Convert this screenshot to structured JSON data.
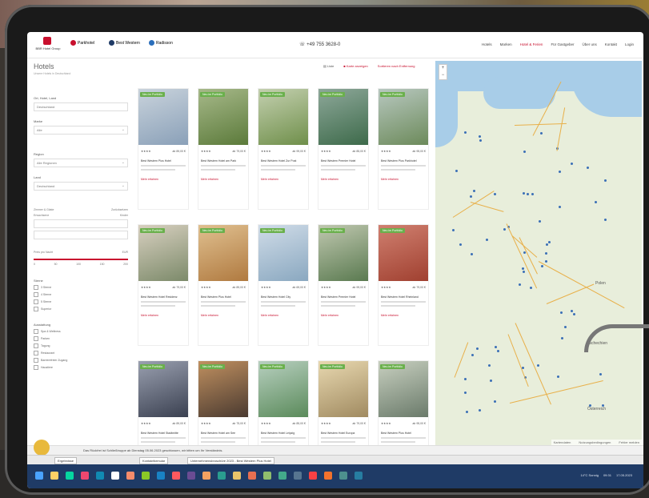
{
  "header": {
    "logo_text": "BBR Hotel Group",
    "partner_logos": [
      "Parkhotel",
      "Best Western",
      "Radisson"
    ],
    "phone": "+49 755 3628-0",
    "nav": [
      "Hotels",
      "Marken",
      "Hotel & Ferien",
      "Für Gastgeber",
      "Über uns",
      "Kontakt",
      "Login"
    ]
  },
  "page": {
    "title": "Hotels",
    "subtitle": "Unsere Hotels in Deutschland"
  },
  "sortbar": {
    "view": "Liste",
    "map_toggle": "Karte anzeigen",
    "sort": "Sortieren nach Entfernung"
  },
  "filters": {
    "search_label": "Ort, Hotel, Land",
    "search_value": "Deutschland",
    "brand_label": "Marke",
    "brand_value": "Alle",
    "region_label": "Region",
    "region_value": "Alle Regionen",
    "country_label": "Land",
    "country_value": "Deutschland",
    "rooms_label": "Zimmer & Gäste",
    "rooms_reset": "Zurücksetzen",
    "guests_cols": [
      "Erwachsene",
      "Kinder"
    ],
    "price_label": "Preis pro Nacht",
    "price_unit": "EUR",
    "price_ticks": [
      "0",
      "50",
      "100",
      "150",
      "200"
    ],
    "stars_label": "Sterne",
    "stars_options": [
      "3 Sterne",
      "4 Sterne",
      "5 Sterne",
      "Superior"
    ],
    "amenity_label": "Ausstattung",
    "amenity_options": [
      "Spa & Wellness",
      "Parken",
      "Tagung",
      "Restaurant",
      "Barrierefreier Zugang",
      "Haustiere"
    ]
  },
  "hotels": [
    {
      "badge": "Neu im Portfolio",
      "stars": "★★★★",
      "price": "ab 89,00 €",
      "name": "Best Western Plus Hotel",
      "more": "Mehr erfahren"
    },
    {
      "badge": "Neu im Portfolio",
      "stars": "★★★★",
      "price": "ab 79,00 €",
      "name": "Best Western Hotel am Park",
      "more": "Mehr erfahren"
    },
    {
      "badge": "Neu im Portfolio",
      "stars": "★★★★",
      "price": "ab 99,00 €",
      "name": "Best Western Hotel Zur Post",
      "more": "Mehr erfahren"
    },
    {
      "badge": "Neu im Portfolio",
      "stars": "★★★★",
      "price": "ab 85,00 €",
      "name": "Best Western Premier Hotel",
      "more": "Mehr erfahren"
    },
    {
      "badge": "Neu im Portfolio",
      "stars": "★★★★",
      "price": "ab 95,00 €",
      "name": "Best Western Plus Parkhotel",
      "more": "Mehr erfahren"
    },
    {
      "badge": "Neu im Portfolio",
      "stars": "★★★★",
      "price": "ab 79,00 €",
      "name": "Best Western Hotel Residenz",
      "more": "Mehr erfahren"
    },
    {
      "badge": "Neu im Portfolio",
      "stars": "★★★★",
      "price": "ab 89,00 €",
      "name": "Best Western Plus Hotel",
      "more": "Mehr erfahren"
    },
    {
      "badge": "Neu im Portfolio",
      "stars": "★★★★",
      "price": "ab 69,00 €",
      "name": "Best Western Hotel City",
      "more": "Mehr erfahren"
    },
    {
      "badge": "Neu im Portfolio",
      "stars": "★★★★",
      "price": "ab 99,00 €",
      "name": "Best Western Premier Hotel",
      "more": "Mehr erfahren"
    },
    {
      "badge": "Neu im Portfolio",
      "stars": "★★★★",
      "price": "ab 79,00 €",
      "name": "Best Western Hotel Rheinland",
      "more": "Mehr erfahren"
    },
    {
      "badge": "Neu im Portfolio",
      "stars": "★★★★",
      "price": "ab 89,00 €",
      "name": "Best Western Hotel Stadtmitte",
      "more": "Mehr erfahren"
    },
    {
      "badge": "Neu im Portfolio",
      "stars": "★★★★",
      "price": "ab 75,00 €",
      "name": "Best Western Hotel am See",
      "more": "Mehr erfahren"
    },
    {
      "badge": "Neu im Portfolio",
      "stars": "★★★★",
      "price": "ab 85,00 €",
      "name": "Best Western Hotel Leipzig",
      "more": "Mehr erfahren"
    },
    {
      "badge": "Neu im Portfolio",
      "stars": "★★★★",
      "price": "ab 79,00 €",
      "name": "Best Western Hotel Europa",
      "more": "Mehr erfahren"
    },
    {
      "badge": "Neu im Portfolio",
      "stars": "★★★★",
      "price": "ab 95,00 €",
      "name": "Best Western Plus Hotel",
      "more": "Mehr erfahren"
    }
  ],
  "map": {
    "labels": [
      "Polen",
      "Tschechien",
      "Österreich"
    ],
    "attribution": [
      "Kartendaten",
      "Nutzungsbedingungen",
      "Fehler melden"
    ]
  },
  "cookie": {
    "text": "Das Rückfrei ist Schließtruppe ab Dienstag 05.06.2023 geschlossen, wir bitten um Ihr Verständnis."
  },
  "browserbar": {
    "items": [
      "Ergebnisse",
      "Kontaktformular",
      "Unternehmensbroschüre 2023 - Best Western Plus Hotel"
    ]
  },
  "taskbar": {
    "weather": "14°C Sonnig",
    "time": "09:31",
    "date": "17.05.2023"
  },
  "colors": {
    "accent": "#c8102e",
    "badge": "#6ab04c",
    "taskbar": "#1f3b66"
  }
}
